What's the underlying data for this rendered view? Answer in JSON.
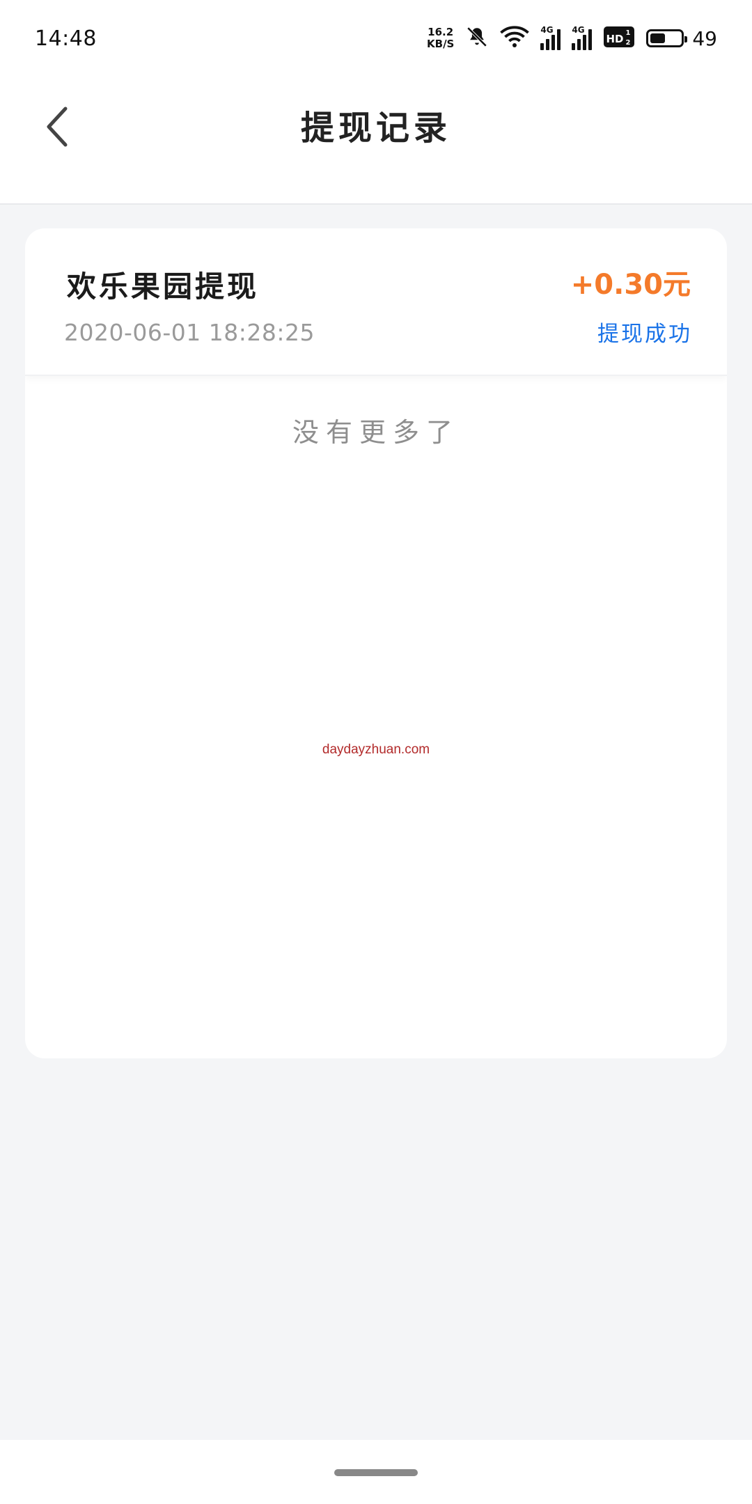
{
  "status_bar": {
    "time": "14:48",
    "net_speed_value": "16.2",
    "net_speed_unit": "KB/S",
    "signal1_tag": "4G",
    "signal2_tag": "4G",
    "hd_label": "HD",
    "battery_level": "49",
    "battery_fraction": 0.49,
    "icons": [
      "mute-bell-icon",
      "wifi-icon",
      "signal-4g-icon",
      "signal-4g-icon",
      "hd-icon",
      "battery-icon"
    ]
  },
  "nav": {
    "back_icon": "chevron-left-icon",
    "title": "提现记录"
  },
  "records": [
    {
      "title": "欢乐果园提现",
      "time": "2020-06-01 18:28:25",
      "amount": "+0.30元",
      "status": "提现成功"
    }
  ],
  "list_footer": "没有更多了",
  "watermark": "daydayzhuan.com",
  "colors": {
    "amount": "#f47a2a",
    "status": "#1a73e8",
    "background": "#f4f5f7",
    "watermark": "#b22a2a"
  }
}
